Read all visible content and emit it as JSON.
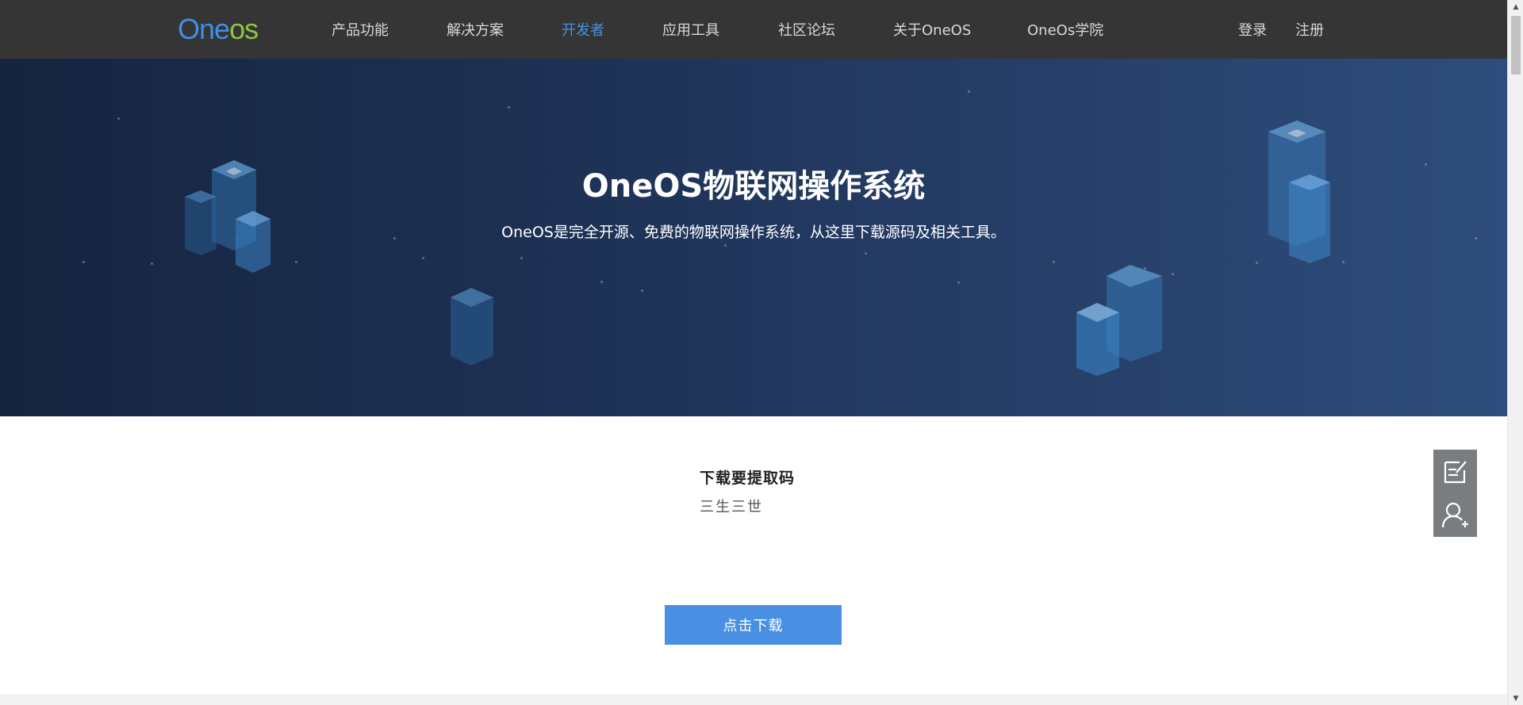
{
  "header": {
    "logo_text_1": "O",
    "logo_text_2": "ne",
    "logo_text_3": "os",
    "nav": [
      {
        "label": "产品功能"
      },
      {
        "label": "解决方案"
      },
      {
        "label": "开发者"
      },
      {
        "label": "应用工具"
      },
      {
        "label": "社区论坛"
      },
      {
        "label": "关于OneOS"
      },
      {
        "label": "OneOs学院"
      }
    ],
    "active_nav": "开发者",
    "login_label": "登录",
    "register_label": "注册"
  },
  "banner": {
    "title": "OneOS物联网操作系统",
    "subtitle": "OneOS是完全开源、免费的物联网操作系统，从这里下载源码及相关工具。"
  },
  "content": {
    "code_title": "下载要提取码",
    "code_value": "三生三世",
    "download_label": "点击下载"
  },
  "side_tools": {
    "icons": [
      "edit-note-icon",
      "add-user-icon"
    ]
  },
  "colors": {
    "topbar": "#353535",
    "accent": "#4a90e2",
    "logo_green": "#8cc63f",
    "banner_dark": "#16243f",
    "banner_light": "#2e4d7c"
  }
}
